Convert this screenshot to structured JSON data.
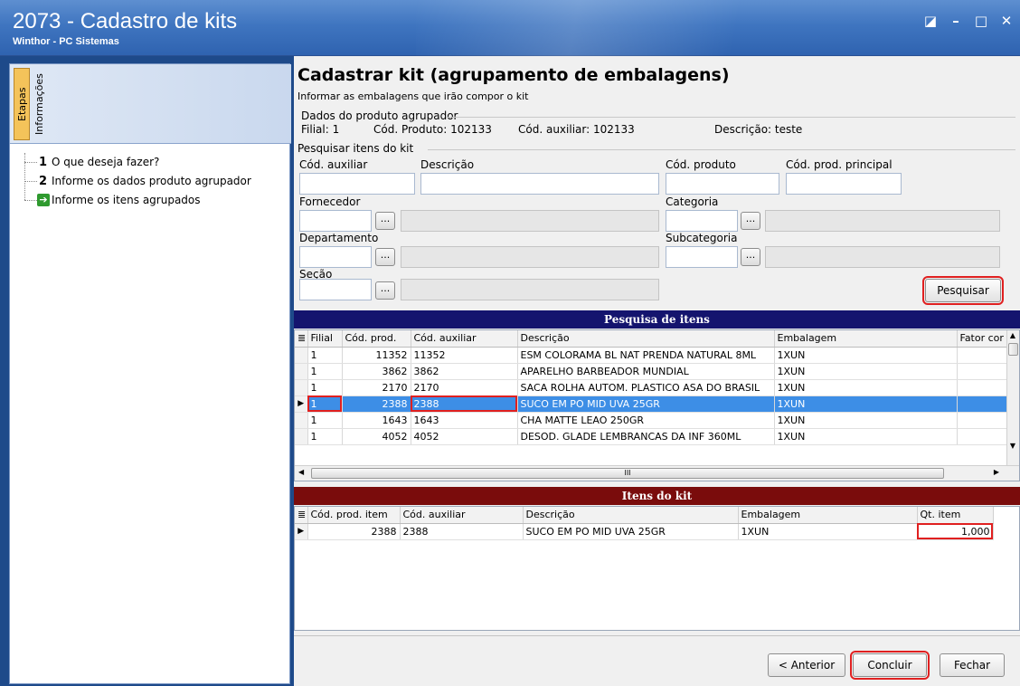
{
  "window": {
    "title": "2073 - Cadastro de kits",
    "subtitle": "Winthor - PC Sistemas",
    "controls": {
      "restore": "◪",
      "minimize": "–",
      "maximize": "□",
      "close": "✕"
    }
  },
  "left_panel": {
    "tabs": [
      "Etapas",
      "Informações"
    ],
    "steps": [
      {
        "num": "1",
        "label": "O que deseja fazer?"
      },
      {
        "num": "2",
        "label": "Informe os dados produto agrupador"
      },
      {
        "num": "",
        "label": "Informe os itens agrupados",
        "icon": "green-arrow-icon"
      }
    ]
  },
  "page": {
    "title": "Cadastrar kit (agrupamento de embalagens)",
    "subtitle": "Informar as embalagens que irão compor o kit"
  },
  "agrupador": {
    "group_title": "Dados do produto agrupador",
    "filial": "Filial: 1",
    "cod_produto": "Cód. Produto: 102133",
    "cod_auxiliar": "Cód. auxiliar: 102133",
    "descricao": "Descrição: teste"
  },
  "search_form": {
    "group_title": "Pesquisar itens do kit",
    "labels": {
      "cod_auxiliar": "Cód. auxiliar",
      "descricao": "Descrição",
      "cod_produto": "Cód. produto",
      "cod_prod_principal": "Cód. prod. principal",
      "fornecedor": "Fornecedor",
      "categoria": "Categoria",
      "departamento": "Departamento",
      "subcategoria": "Subcategoria",
      "secao": "Seção"
    },
    "dots": "...",
    "search_button": "Pesquisar"
  },
  "search_grid": {
    "header": "Pesquisa de itens",
    "header_color": "#14146e",
    "columns": [
      "Filial",
      "Cód. prod.",
      "Cód. auxiliar",
      "Descrição",
      "Embalagem",
      "Fator cor"
    ],
    "rows": [
      [
        "1",
        "11352",
        "11352",
        "ESM COLORAMA BL NAT PRENDA NATURAL 8ML",
        "1XUN",
        ""
      ],
      [
        "1",
        "3862",
        "3862",
        "APARELHO BARBEADOR MUNDIAL",
        "1XUN",
        ""
      ],
      [
        "1",
        "2170",
        "2170",
        "SACA ROLHA AUTOM. PLASTICO ASA DO BRASIL",
        "1XUN",
        ""
      ],
      [
        "1",
        "2388",
        "2388",
        "SUCO EM PO MID UVA 25GR",
        "1XUN",
        ""
      ],
      [
        "1",
        "1643",
        "1643",
        "CHA MATTE LEAO 250GR",
        "1XUN",
        ""
      ],
      [
        "1",
        "4052",
        "4052",
        "DESOD. GLADE LEMBRANCAS DA INF 360ML",
        "1XUN",
        ""
      ]
    ],
    "selected_index": 3,
    "scroll_label": "III"
  },
  "kit_grid": {
    "header": "Itens do kit",
    "header_color": "#7a0c0c",
    "columns": [
      "Cód. prod. item",
      "Cód. auxiliar",
      "Descrição",
      "Embalagem",
      "Qt. item"
    ],
    "rows": [
      [
        "2388",
        "2388",
        "SUCO EM PO MID UVA 25GR",
        "1XUN",
        "1,000"
      ]
    ]
  },
  "footer": {
    "anterior": "< Anterior",
    "concluir": "Concluir",
    "fechar": "Fechar"
  },
  "colors": {
    "title_bar": "#3f75c0",
    "selection": "#3d8ee6",
    "highlight": "#e02020"
  }
}
